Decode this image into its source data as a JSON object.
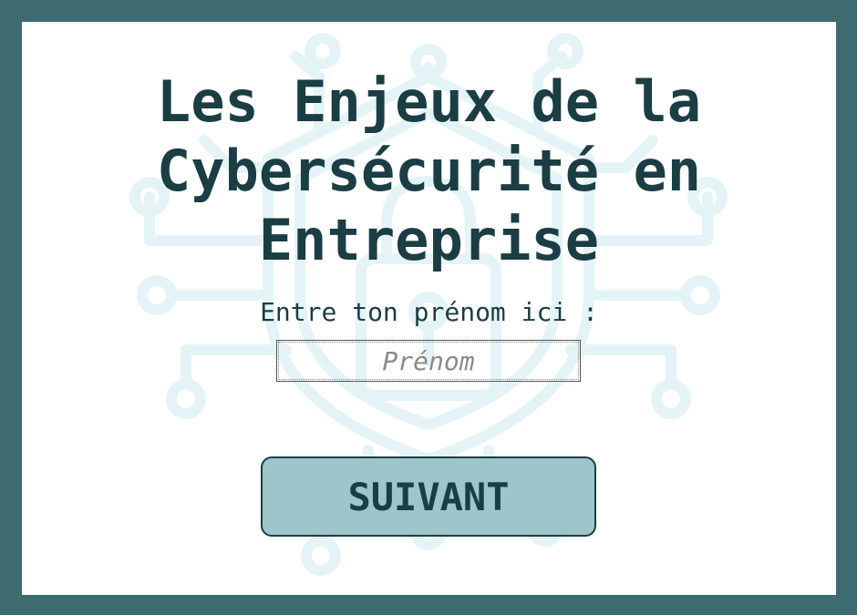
{
  "page": {
    "title": "Les Enjeux de la Cybersécurité en Entreprise",
    "prompt_label": "Entre ton prénom ici :",
    "name_input": {
      "value": "",
      "placeholder": "Prénom"
    },
    "next_button_label": "SUIVANT"
  },
  "background": {
    "icon": "shield-lock-circuit-icon"
  },
  "colors": {
    "frame": "#3d6b6f",
    "card": "#ffffff",
    "text": "#1b3d44",
    "button": "#9dc6ca",
    "illustration": "#e4f4f6"
  }
}
